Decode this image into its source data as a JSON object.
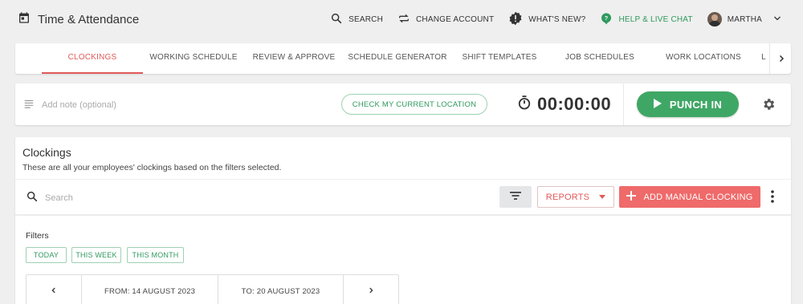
{
  "header": {
    "title": "Time & Attendance",
    "nav": {
      "search": "SEARCH",
      "change_account": "CHANGE ACCOUNT",
      "whats_new": "WHAT'S NEW?",
      "help": "HELP & LIVE CHAT",
      "user": "MARTHA"
    }
  },
  "tabs": [
    {
      "label": "CLOCKINGS",
      "active": true
    },
    {
      "label": "WORKING SCHEDULE"
    },
    {
      "label": "REVIEW & APPROVE"
    },
    {
      "label": "SCHEDULE GENERATOR"
    },
    {
      "label": "SHIFT TEMPLATES"
    },
    {
      "label": "JOB SCHEDULES"
    },
    {
      "label": "WORK LOCATIONS"
    },
    {
      "label": "L"
    }
  ],
  "punch_bar": {
    "note_placeholder": "Add note (optional)",
    "location_button": "CHECK MY CURRENT LOCATION",
    "timer": "00:00:00",
    "punch_button": "PUNCH IN"
  },
  "clockings": {
    "title": "Clockings",
    "subtitle": "These are all your employees' clockings based on the filters selected.",
    "search_placeholder": "Search",
    "reports_label": "REPORTS",
    "add_label": "ADD MANUAL CLOCKING",
    "filters_label": "Filters",
    "chips": [
      "TODAY",
      "THIS WEEK",
      "THIS MONTH"
    ],
    "date_from": "FROM: 14 AUGUST 2023",
    "date_to": "TO: 20 AUGUST 2023"
  },
  "colors": {
    "accent_red": "#e15a5a",
    "accent_green": "#3fa765",
    "background": "#efefef"
  }
}
